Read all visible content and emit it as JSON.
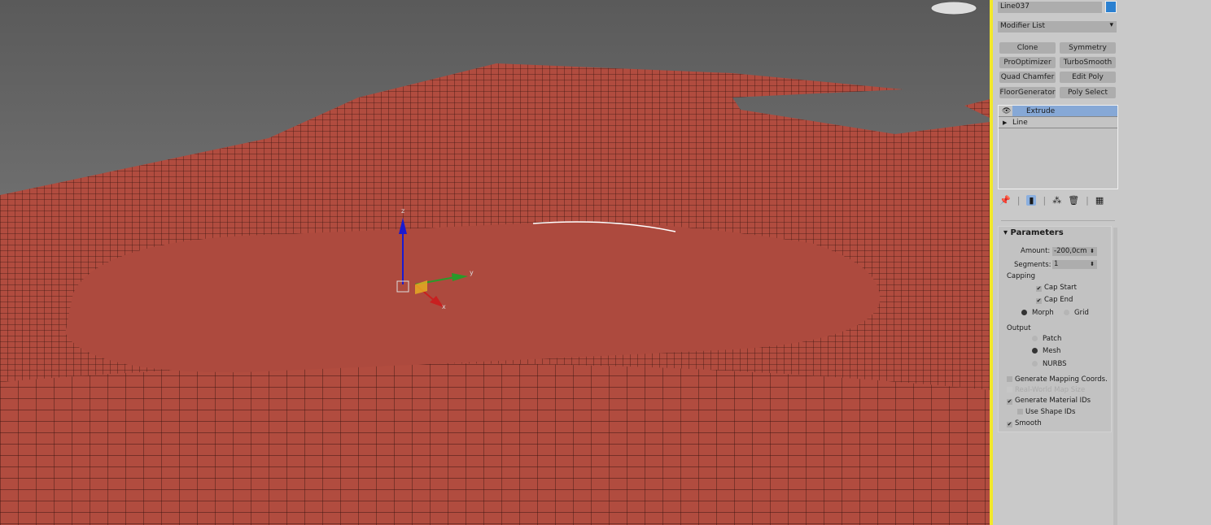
{
  "object_name": "Line037",
  "object_color": "#2b80d0",
  "modifier_list": "Modifier List",
  "modifier_buttons": [
    "Clone",
    "Symmetry",
    "ProOptimizer",
    "TurboSmooth",
    "Quad Chamfer",
    "Edit Poly",
    "FloorGenerator",
    "Poly Select"
  ],
  "stack": [
    {
      "label": "Extrude",
      "selected": true
    },
    {
      "label": "Line",
      "selected": false
    }
  ],
  "params": {
    "title": "Parameters",
    "amount_label": "Amount:",
    "amount": "-200,0cm",
    "segments_label": "Segments:",
    "segments": "1",
    "capping": "Capping",
    "cap_start": "Cap Start",
    "cap_end": "Cap End",
    "morph": "Morph",
    "grid": "Grid",
    "output": "Output",
    "patch": "Patch",
    "mesh": "Mesh",
    "nurbs": "NURBS",
    "gen_mapping": "Generate Mapping Coords.",
    "real_world": "Real-World Map Size",
    "gen_mat_ids": "Generate Material IDs",
    "use_shape_ids": "Use Shape IDs",
    "smooth": "Smooth"
  },
  "gizmo": {
    "x": "x",
    "y": "y",
    "z": "z"
  },
  "colors": {
    "mesh": "#b14c3f",
    "highlight": "#f2e82a",
    "selection": "#86a8d6"
  }
}
